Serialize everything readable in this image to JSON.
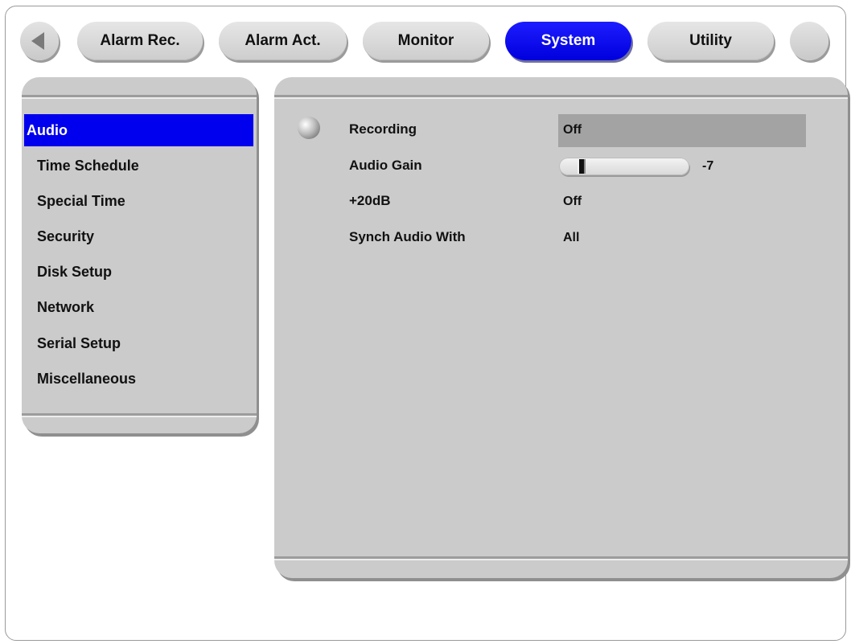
{
  "tabs": [
    {
      "label": "Alarm Rec.",
      "active": false
    },
    {
      "label": "Alarm Act.",
      "active": false
    },
    {
      "label": "Monitor",
      "active": false
    },
    {
      "label": "System",
      "active": true
    },
    {
      "label": "Utility",
      "active": false
    }
  ],
  "sidebar": {
    "items": [
      {
        "label": "Audio",
        "selected": true
      },
      {
        "label": "Time Schedule"
      },
      {
        "label": "Special Time"
      },
      {
        "label": "Security"
      },
      {
        "label": "Disk Setup"
      },
      {
        "label": "Network"
      },
      {
        "label": "Serial Setup"
      },
      {
        "label": "Miscellaneous"
      }
    ]
  },
  "settings": {
    "recording": {
      "label": "Recording",
      "value": "Off"
    },
    "audio_gain": {
      "label": "Audio Gain",
      "value": "-7",
      "slider_fraction": 0.1
    },
    "plus20db": {
      "label": "+20dB",
      "value": "Off"
    },
    "synch_audio": {
      "label": "Synch Audio With",
      "value": "All"
    }
  },
  "colors": {
    "accent": "#0000ee",
    "panel": "#cbcbcb",
    "selected_value_bg": "#a3a3a3"
  },
  "icons": {
    "back": "left-arrow-icon",
    "bullet": "radio-bullet-icon"
  }
}
